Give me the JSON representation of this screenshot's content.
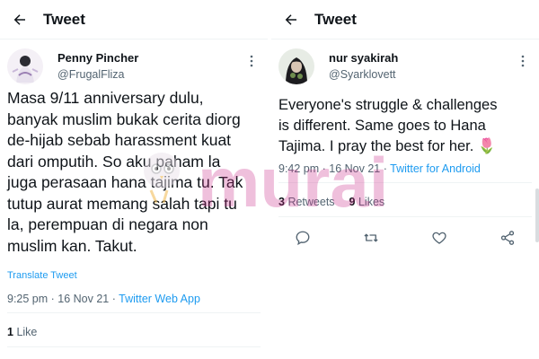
{
  "left": {
    "topbar": {
      "title": "Tweet"
    },
    "author": {
      "name": "Penny Pincher",
      "handle": "@FrugalFliza"
    },
    "tweet": {
      "text": "Masa 9/11 anniversary dulu,\nbanyak muslim bukak cerita diorg\nde-hijab sebab harassment kuat\ndari omputih. So aku paham la\njuga perasaan hana tajima tu. Tak\ntutup aurat memang salah tapi tu\nla, perempuan di negara non\nmuslim kan. Takut.",
      "translate_label": "Translate Tweet",
      "time": "9:25 pm · 16 Nov 21 · ",
      "source": "Twitter Web App"
    },
    "stats": {
      "likes_count": "1",
      "likes_label": "Like"
    }
  },
  "right": {
    "topbar": {
      "title": "Tweet"
    },
    "author": {
      "name": "nur syakirah",
      "handle": "@Syarklovett"
    },
    "tweet": {
      "text": "Everyone's struggle & challenges\nis different. Same goes to Hana\nTajima. I pray the best for her. 🌷",
      "time": "9:42 pm · 16 Nov 21 · ",
      "source": "Twitter for Android"
    },
    "stats": {
      "retweets_count": "3",
      "retweets_label": "Retweets",
      "likes_count": "9",
      "likes_label": "Likes"
    }
  },
  "watermark": {
    "text": "murai"
  },
  "icons": {
    "back": "arrow-left-icon",
    "more": "more-vertical-icon",
    "reply": "reply-icon",
    "retweet": "retweet-icon",
    "like": "heart-icon",
    "share": "share-icon"
  },
  "colors": {
    "link": "#1d9bf0",
    "muted": "#536471",
    "text": "#0f1419",
    "watermark": "#cc2f8a"
  }
}
